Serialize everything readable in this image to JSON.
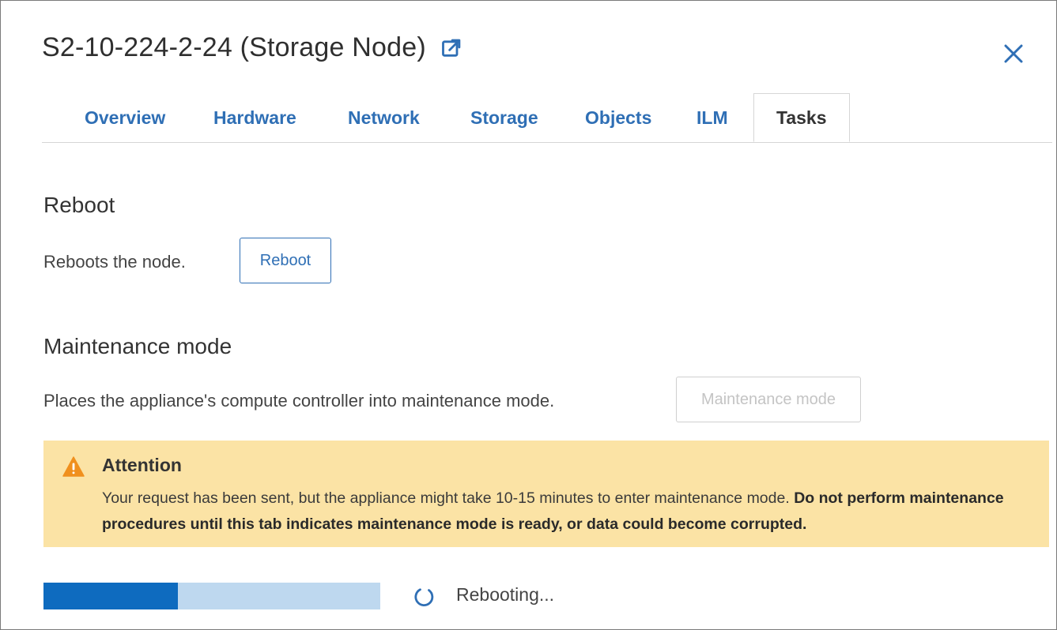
{
  "modal": {
    "title": "S2-10-224-2-24 (Storage Node)",
    "external_link_icon": "external-link-icon",
    "close_icon": "close-icon"
  },
  "tabs": [
    {
      "label": "Overview",
      "active": false
    },
    {
      "label": "Hardware",
      "active": false
    },
    {
      "label": "Network",
      "active": false
    },
    {
      "label": "Storage",
      "active": false
    },
    {
      "label": "Objects",
      "active": false
    },
    {
      "label": "ILM",
      "active": false
    },
    {
      "label": "Tasks",
      "active": true
    }
  ],
  "reboot": {
    "title": "Reboot",
    "description": "Reboots the node.",
    "button_label": "Reboot"
  },
  "maintenance": {
    "title": "Maintenance mode",
    "description": "Places the appliance's compute controller into maintenance mode.",
    "button_label": "Maintenance mode",
    "button_disabled": true
  },
  "alert": {
    "icon": "warning-icon",
    "title": "Attention",
    "text": "Your request has been sent, but the appliance might take 10-15 minutes to enter maintenance mode.",
    "bold_text": "Do not perform maintenance procedures until this tab indicates maintenance mode is ready, or data could become corrupted."
  },
  "progress": {
    "fraction": 0.4,
    "status_text": "Rebooting..."
  },
  "colors": {
    "link_blue": "#2f6fb5",
    "progress_fill": "#0e6bbf",
    "progress_track": "#bed8ef",
    "alert_background": "#fbe3a5",
    "warning_orange": "#f0901e"
  }
}
